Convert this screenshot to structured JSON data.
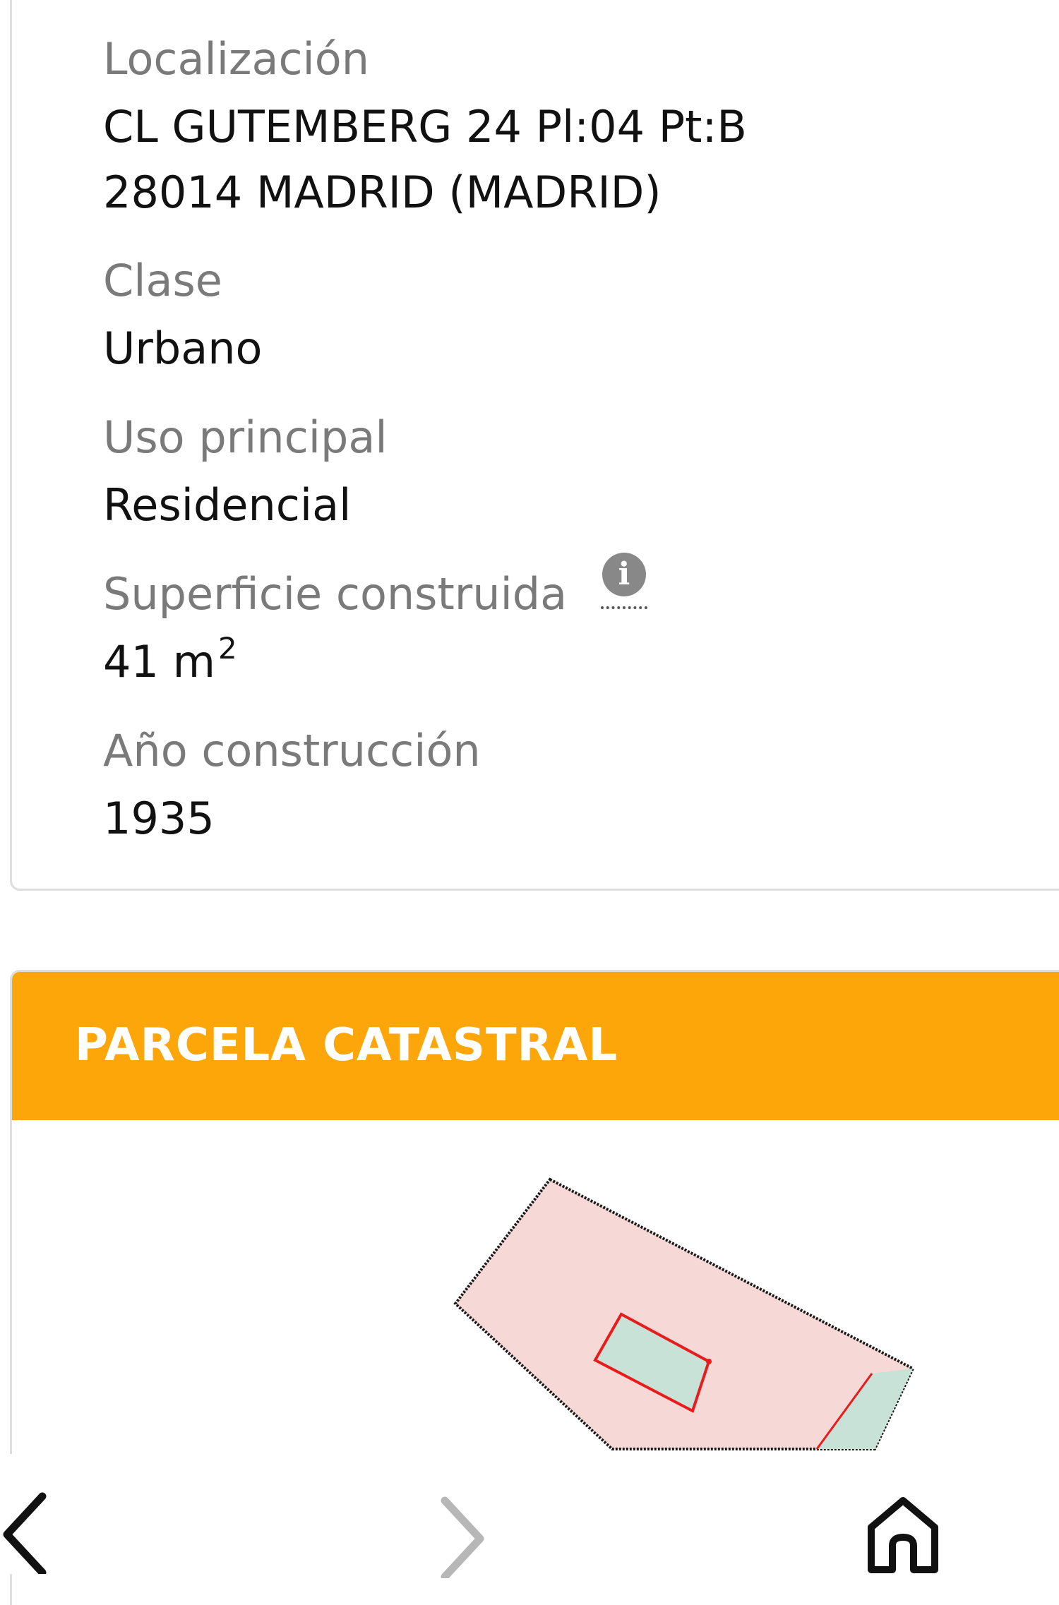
{
  "fields": {
    "localizacion": {
      "label": "Localización",
      "line1": "CL GUTEMBERG 24 Pl:04 Pt:B",
      "line2": "28014 MADRID (MADRID)"
    },
    "clase": {
      "label": "Clase",
      "value": "Urbano"
    },
    "uso": {
      "label": "Uso principal",
      "value": "Residencial"
    },
    "superficie": {
      "label": "Superficie construida",
      "value": "41 m",
      "unit_sup": "2",
      "info_icon": "info-icon"
    },
    "anio": {
      "label": "Año construcción",
      "value": "1935"
    }
  },
  "parcela": {
    "title": "PARCELA CATASTRAL",
    "header_color": "#fda609",
    "parcel_fill": "#f6d9d7",
    "unit_fill": "#c8e2d7",
    "unit_stroke": "#e81c1c"
  },
  "nav": {
    "back_icon": "chevron-left-icon",
    "forward_icon": "chevron-right-icon",
    "home_icon": "home-icon"
  }
}
